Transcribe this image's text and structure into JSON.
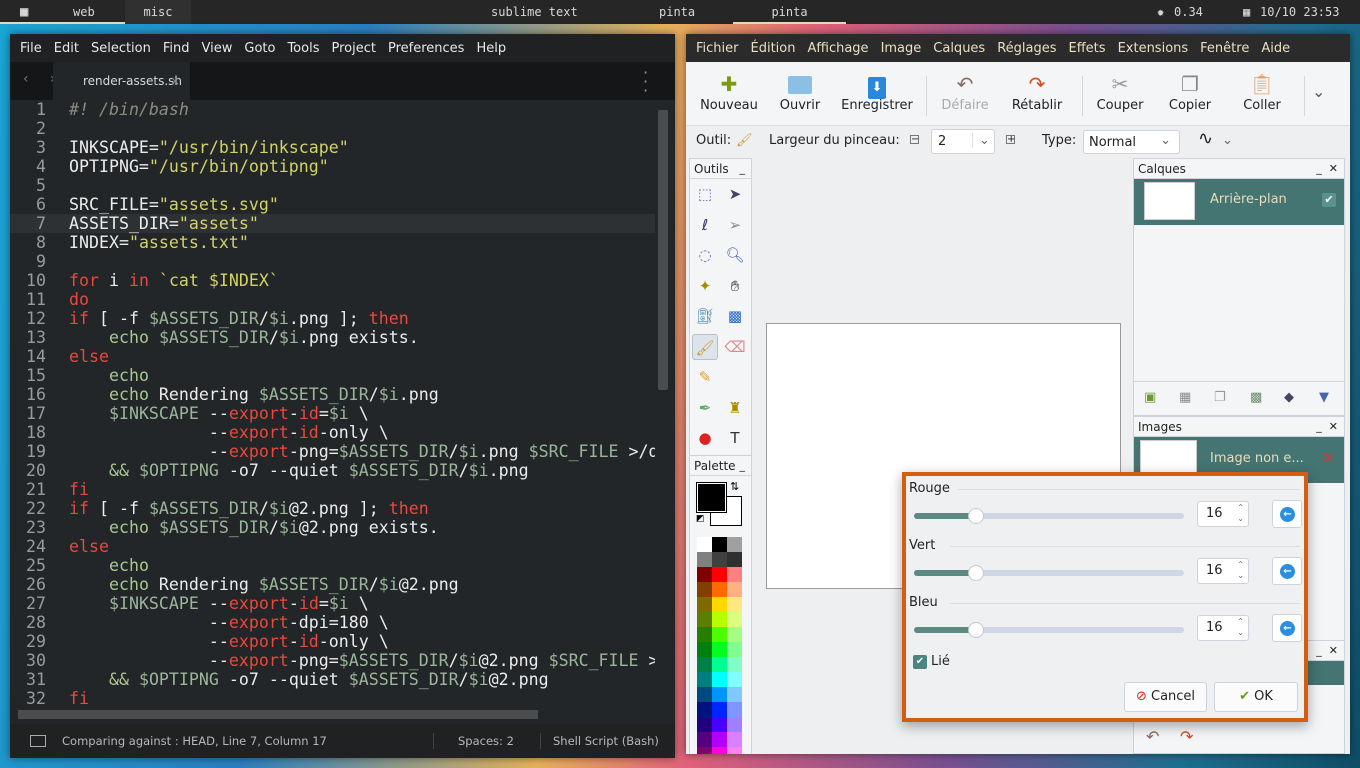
{
  "topbar": {
    "workspaces": [
      "web",
      "misc"
    ],
    "windows": [
      "sublime text",
      "pinta",
      "pinta"
    ],
    "cpu": "0.34",
    "datetime": "10/10 23:53"
  },
  "sublime": {
    "menu": [
      "File",
      "Edit",
      "Selection",
      "Find",
      "View",
      "Goto",
      "Tools",
      "Project",
      "Preferences",
      "Help"
    ],
    "tab": "render-assets.sh",
    "current_line": 7,
    "lines": [
      [
        [
          "c",
          "#! /bin/bash"
        ]
      ],
      [],
      [
        [
          "p",
          "INKSCAPE="
        ],
        [
          "s",
          "\"/usr/bin/inkscape\""
        ]
      ],
      [
        [
          "p",
          "OPTIPNG="
        ],
        [
          "s",
          "\"/usr/bin/optipng\""
        ]
      ],
      [],
      [
        [
          "p",
          "SRC_FILE="
        ],
        [
          "s",
          "\"assets.svg\""
        ]
      ],
      [
        [
          "p",
          "ASSETS_DIR="
        ],
        [
          "s",
          "\"assets\""
        ]
      ],
      [
        [
          "p",
          "INDEX="
        ],
        [
          "s",
          "\"assets.txt\""
        ]
      ],
      [],
      [
        [
          "k",
          "for"
        ],
        [
          "p",
          " i "
        ],
        [
          "k",
          "in"
        ],
        [
          "p",
          " "
        ],
        [
          "s",
          "`cat $INDEX`"
        ]
      ],
      [
        [
          "k",
          "do"
        ]
      ],
      [
        [
          "k",
          "if"
        ],
        [
          "p",
          " [ -f "
        ],
        [
          "v",
          "$ASSETS_DIR"
        ],
        [
          "p",
          "/"
        ],
        [
          "v",
          "$i"
        ],
        [
          "p",
          ".png ]; "
        ],
        [
          "k",
          "then"
        ]
      ],
      [
        [
          "p",
          "    "
        ],
        [
          "e",
          "echo"
        ],
        [
          "p",
          " "
        ],
        [
          "v",
          "$ASSETS_DIR"
        ],
        [
          "p",
          "/"
        ],
        [
          "v",
          "$i"
        ],
        [
          "p",
          ".png exists."
        ]
      ],
      [
        [
          "k",
          "else"
        ]
      ],
      [
        [
          "p",
          "    "
        ],
        [
          "e",
          "echo"
        ]
      ],
      [
        [
          "p",
          "    "
        ],
        [
          "e",
          "echo"
        ],
        [
          "p",
          " Rendering "
        ],
        [
          "v",
          "$ASSETS_DIR"
        ],
        [
          "p",
          "/"
        ],
        [
          "v",
          "$i"
        ],
        [
          "p",
          ".png"
        ]
      ],
      [
        [
          "p",
          "    "
        ],
        [
          "v",
          "$INKSCAPE"
        ],
        [
          "p",
          " --"
        ],
        [
          "k",
          "export"
        ],
        [
          "p",
          "-"
        ],
        [
          "k",
          "id"
        ],
        [
          "p",
          "="
        ],
        [
          "v",
          "$i"
        ],
        [
          "p",
          " \\"
        ]
      ],
      [
        [
          "p",
          "              --"
        ],
        [
          "k",
          "export"
        ],
        [
          "p",
          "-"
        ],
        [
          "k",
          "id"
        ],
        [
          "p",
          "-only \\"
        ]
      ],
      [
        [
          "p",
          "              --"
        ],
        [
          "k",
          "export"
        ],
        [
          "p",
          "-png="
        ],
        [
          "v",
          "$ASSETS_DIR"
        ],
        [
          "p",
          "/"
        ],
        [
          "v",
          "$i"
        ],
        [
          "p",
          ".png "
        ],
        [
          "v",
          "$SRC_FILE"
        ],
        [
          "p",
          " >/dev/null"
        ]
      ],
      [
        [
          "p",
          "    "
        ],
        [
          "e",
          "&&"
        ],
        [
          "p",
          " "
        ],
        [
          "v",
          "$OPTIPNG"
        ],
        [
          "p",
          " -o7 --quiet "
        ],
        [
          "v",
          "$ASSETS_DIR"
        ],
        [
          "p",
          "/"
        ],
        [
          "v",
          "$i"
        ],
        [
          "p",
          ".png"
        ]
      ],
      [
        [
          "k",
          "fi"
        ]
      ],
      [
        [
          "k",
          "if"
        ],
        [
          "p",
          " [ -f "
        ],
        [
          "v",
          "$ASSETS_DIR"
        ],
        [
          "p",
          "/"
        ],
        [
          "v",
          "$i"
        ],
        [
          "p",
          "@2.png ]; "
        ],
        [
          "k",
          "then"
        ]
      ],
      [
        [
          "p",
          "    "
        ],
        [
          "e",
          "echo"
        ],
        [
          "p",
          " "
        ],
        [
          "v",
          "$ASSETS_DIR"
        ],
        [
          "p",
          "/"
        ],
        [
          "v",
          "$i"
        ],
        [
          "p",
          "@2.png exists."
        ]
      ],
      [
        [
          "k",
          "else"
        ]
      ],
      [
        [
          "p",
          "    "
        ],
        [
          "e",
          "echo"
        ]
      ],
      [
        [
          "p",
          "    "
        ],
        [
          "e",
          "echo"
        ],
        [
          "p",
          " Rendering "
        ],
        [
          "v",
          "$ASSETS_DIR"
        ],
        [
          "p",
          "/"
        ],
        [
          "v",
          "$i"
        ],
        [
          "p",
          "@2.png"
        ]
      ],
      [
        [
          "p",
          "    "
        ],
        [
          "v",
          "$INKSCAPE"
        ],
        [
          "p",
          " --"
        ],
        [
          "k",
          "export"
        ],
        [
          "p",
          "-"
        ],
        [
          "k",
          "id"
        ],
        [
          "p",
          "="
        ],
        [
          "v",
          "$i"
        ],
        [
          "p",
          " \\"
        ]
      ],
      [
        [
          "p",
          "              --"
        ],
        [
          "k",
          "export"
        ],
        [
          "p",
          "-dpi=180 \\"
        ]
      ],
      [
        [
          "p",
          "              --"
        ],
        [
          "k",
          "export"
        ],
        [
          "p",
          "-"
        ],
        [
          "k",
          "id"
        ],
        [
          "p",
          "-only \\"
        ]
      ],
      [
        [
          "p",
          "              --"
        ],
        [
          "k",
          "export"
        ],
        [
          "p",
          "-png="
        ],
        [
          "v",
          "$ASSETS_DIR"
        ],
        [
          "p",
          "/"
        ],
        [
          "v",
          "$i"
        ],
        [
          "p",
          "@2.png "
        ],
        [
          "v",
          "$SRC_FILE"
        ],
        [
          "p",
          " >/dev/null"
        ]
      ],
      [
        [
          "p",
          "    "
        ],
        [
          "e",
          "&&"
        ],
        [
          "p",
          " "
        ],
        [
          "v",
          "$OPTIPNG"
        ],
        [
          "p",
          " -o7 --quiet "
        ],
        [
          "v",
          "$ASSETS_DIR"
        ],
        [
          "p",
          "/"
        ],
        [
          "v",
          "$i"
        ],
        [
          "p",
          "@2.png"
        ]
      ],
      [
        [
          "k",
          "fi"
        ]
      ]
    ],
    "status": {
      "git": "Comparing against : HEAD, Line 7, Column 17",
      "spaces": "Spaces: 2",
      "syntax": "Shell Script (Bash)"
    }
  },
  "pinta": {
    "menu": [
      "Fichier",
      "Édition",
      "Affichage",
      "Image",
      "Calques",
      "Réglages",
      "Effets",
      "Extensions",
      "Fenêtre",
      "Aide"
    ],
    "toolbar": [
      {
        "label": "Nouveau",
        "icon": "new-image-icon"
      },
      {
        "label": "Ouvrir",
        "icon": "folder-icon"
      },
      {
        "label": "Enregistrer",
        "icon": "save-icon"
      },
      {
        "label": "Défaire",
        "icon": "undo-icon",
        "disabled": true
      },
      {
        "label": "Rétablir",
        "icon": "redo-icon"
      },
      {
        "label": "Couper",
        "icon": "scissors-icon"
      },
      {
        "label": "Copier",
        "icon": "copy-icon"
      },
      {
        "label": "Coller",
        "icon": "paste-icon"
      }
    ],
    "options": {
      "tool_label": "Outil:",
      "brush_width_label": "Largeur du pinceau:",
      "brush_width": "2",
      "type_label": "Type:",
      "type": "Normal"
    },
    "tools_title": "Outils",
    "palette_title": "Palette",
    "palette": [
      "#ffffff",
      "#000000",
      "#a0a0a0",
      "#808080",
      "#404040",
      "#303030",
      "#800000",
      "#ff0000",
      "#ff8080",
      "#804000",
      "#ff6a00",
      "#ffb080",
      "#806a00",
      "#ffd800",
      "#ffe880",
      "#5b7f00",
      "#b6ff00",
      "#daff80",
      "#267f00",
      "#4cff00",
      "#a5ff80",
      "#007f0e",
      "#00ff21",
      "#80ff90",
      "#007f46",
      "#00ff90",
      "#80ffc5",
      "#007f7f",
      "#00ffff",
      "#80ffff",
      "#004a7f",
      "#0094ff",
      "#80c8ff",
      "#00137f",
      "#0026ff",
      "#8095ff",
      "#21007f",
      "#4800ff",
      "#a080ff",
      "#57007f",
      "#b200ff",
      "#d880ff",
      "#7f006e",
      "#ff00dc",
      "#ff80ee"
    ],
    "layers": {
      "title": "Calques",
      "items": [
        {
          "name": "Arrière-plan",
          "visible": true
        }
      ]
    },
    "images": {
      "title": "Images",
      "items": [
        {
          "name": "Image non e..."
        }
      ]
    },
    "dialog": {
      "channels": [
        {
          "label": "Rouge",
          "value": "16"
        },
        {
          "label": "Vert",
          "value": "16"
        },
        {
          "label": "Bleu",
          "value": "16"
        }
      ],
      "linked_label": "Lié",
      "linked": true,
      "cancel": "Cancel",
      "ok": "OK"
    },
    "accent": "#447573",
    "dialog_border": "#d45d10"
  }
}
